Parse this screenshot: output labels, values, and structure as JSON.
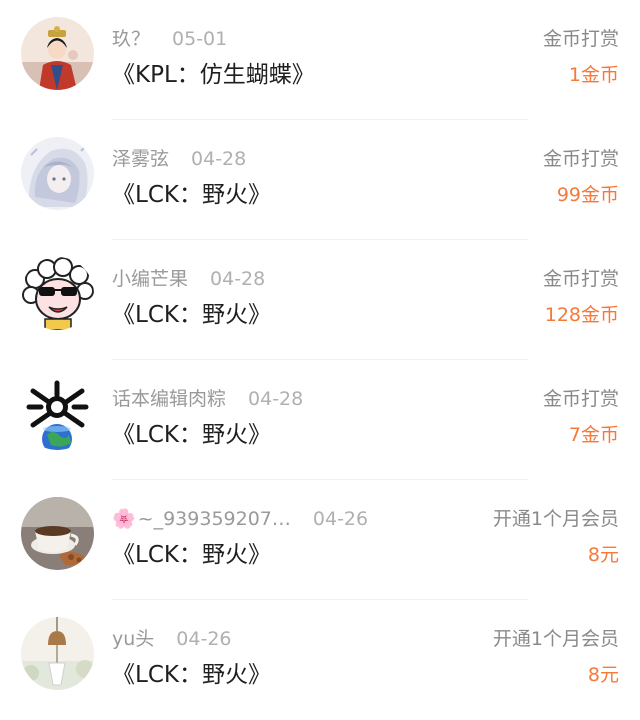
{
  "rows": [
    {
      "name": "玖？",
      "date": "05-01",
      "title": "《KPL：仿生蝴蝶》",
      "type": "金币打赏",
      "amount": "1金币",
      "avatar_icon": "empress-costume-avatar"
    },
    {
      "name": "泽雾弦",
      "date": "04-28",
      "title": "《LCK：野火》",
      "type": "金币打赏",
      "amount": "99金币",
      "avatar_icon": "silver-hair-anime-avatar"
    },
    {
      "name": "小编芒果",
      "date": "04-28",
      "title": "《LCK：野火》",
      "type": "金币打赏",
      "amount": "128金币",
      "avatar_icon": "sheep-sunglasses-avatar"
    },
    {
      "name": "话本编辑肉粽",
      "date": "04-28",
      "title": "《LCK：野火》",
      "type": "金币打赏",
      "amount": "7金币",
      "avatar_icon": "earth-crossbones-avatar"
    },
    {
      "name": "~_939359207…",
      "flower": "🌸",
      "date": "04-26",
      "title": "《LCK：野火》",
      "type": "开通1个月会员",
      "amount": "8元",
      "avatar_icon": "coffee-cup-avatar"
    },
    {
      "name": "yu头",
      "date": "04-26",
      "title": "《LCK：野火》",
      "type": "开通1个月会员",
      "amount": "8元",
      "avatar_icon": "wind-chime-avatar"
    }
  ],
  "colors": {
    "amount": "#f5793a",
    "meta": "#9a9a9a",
    "title": "#1f1f1f"
  }
}
